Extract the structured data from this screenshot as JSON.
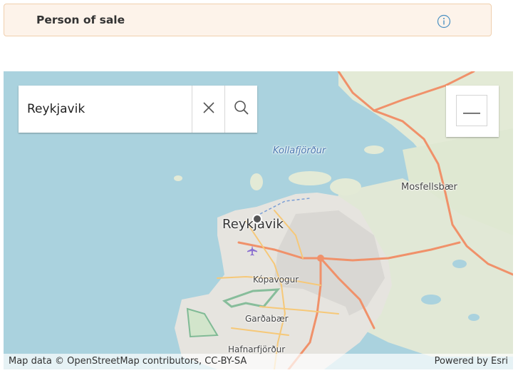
{
  "header": {
    "title": "Person of sale",
    "info_icon": "info-icon"
  },
  "colors": {
    "header_bg": "#fdf3ea",
    "header_border": "#f0cfae",
    "water": "#aad2de",
    "land": "#e4ead9",
    "road_major": "#f0916a",
    "road_minor": "#f6c878",
    "park_outline": "#6fb389",
    "accent_blue": "#4a90c2"
  },
  "search": {
    "value": "Reykjavik",
    "clear_icon": "close-icon",
    "submit_icon": "search-icon"
  },
  "zoom": {
    "zoom_out_icon": "minus-icon"
  },
  "map": {
    "labels": {
      "bay": "Kollafjörður",
      "town_mosfellsbaer": "Mosfellsbær",
      "city_reykjavik": "Reykjavik",
      "town_kopavogur": "Kópavogur",
      "town_gardabaer": "Garðabær",
      "town_hafnarfjordur": "Hafnarfjörður"
    },
    "icons": {
      "airport": "airplane-icon",
      "marker": "location-marker-icon"
    }
  },
  "attribution": {
    "left": "Map data © OpenStreetMap contributors, CC-BY-SA",
    "right": "Powered by Esri"
  }
}
